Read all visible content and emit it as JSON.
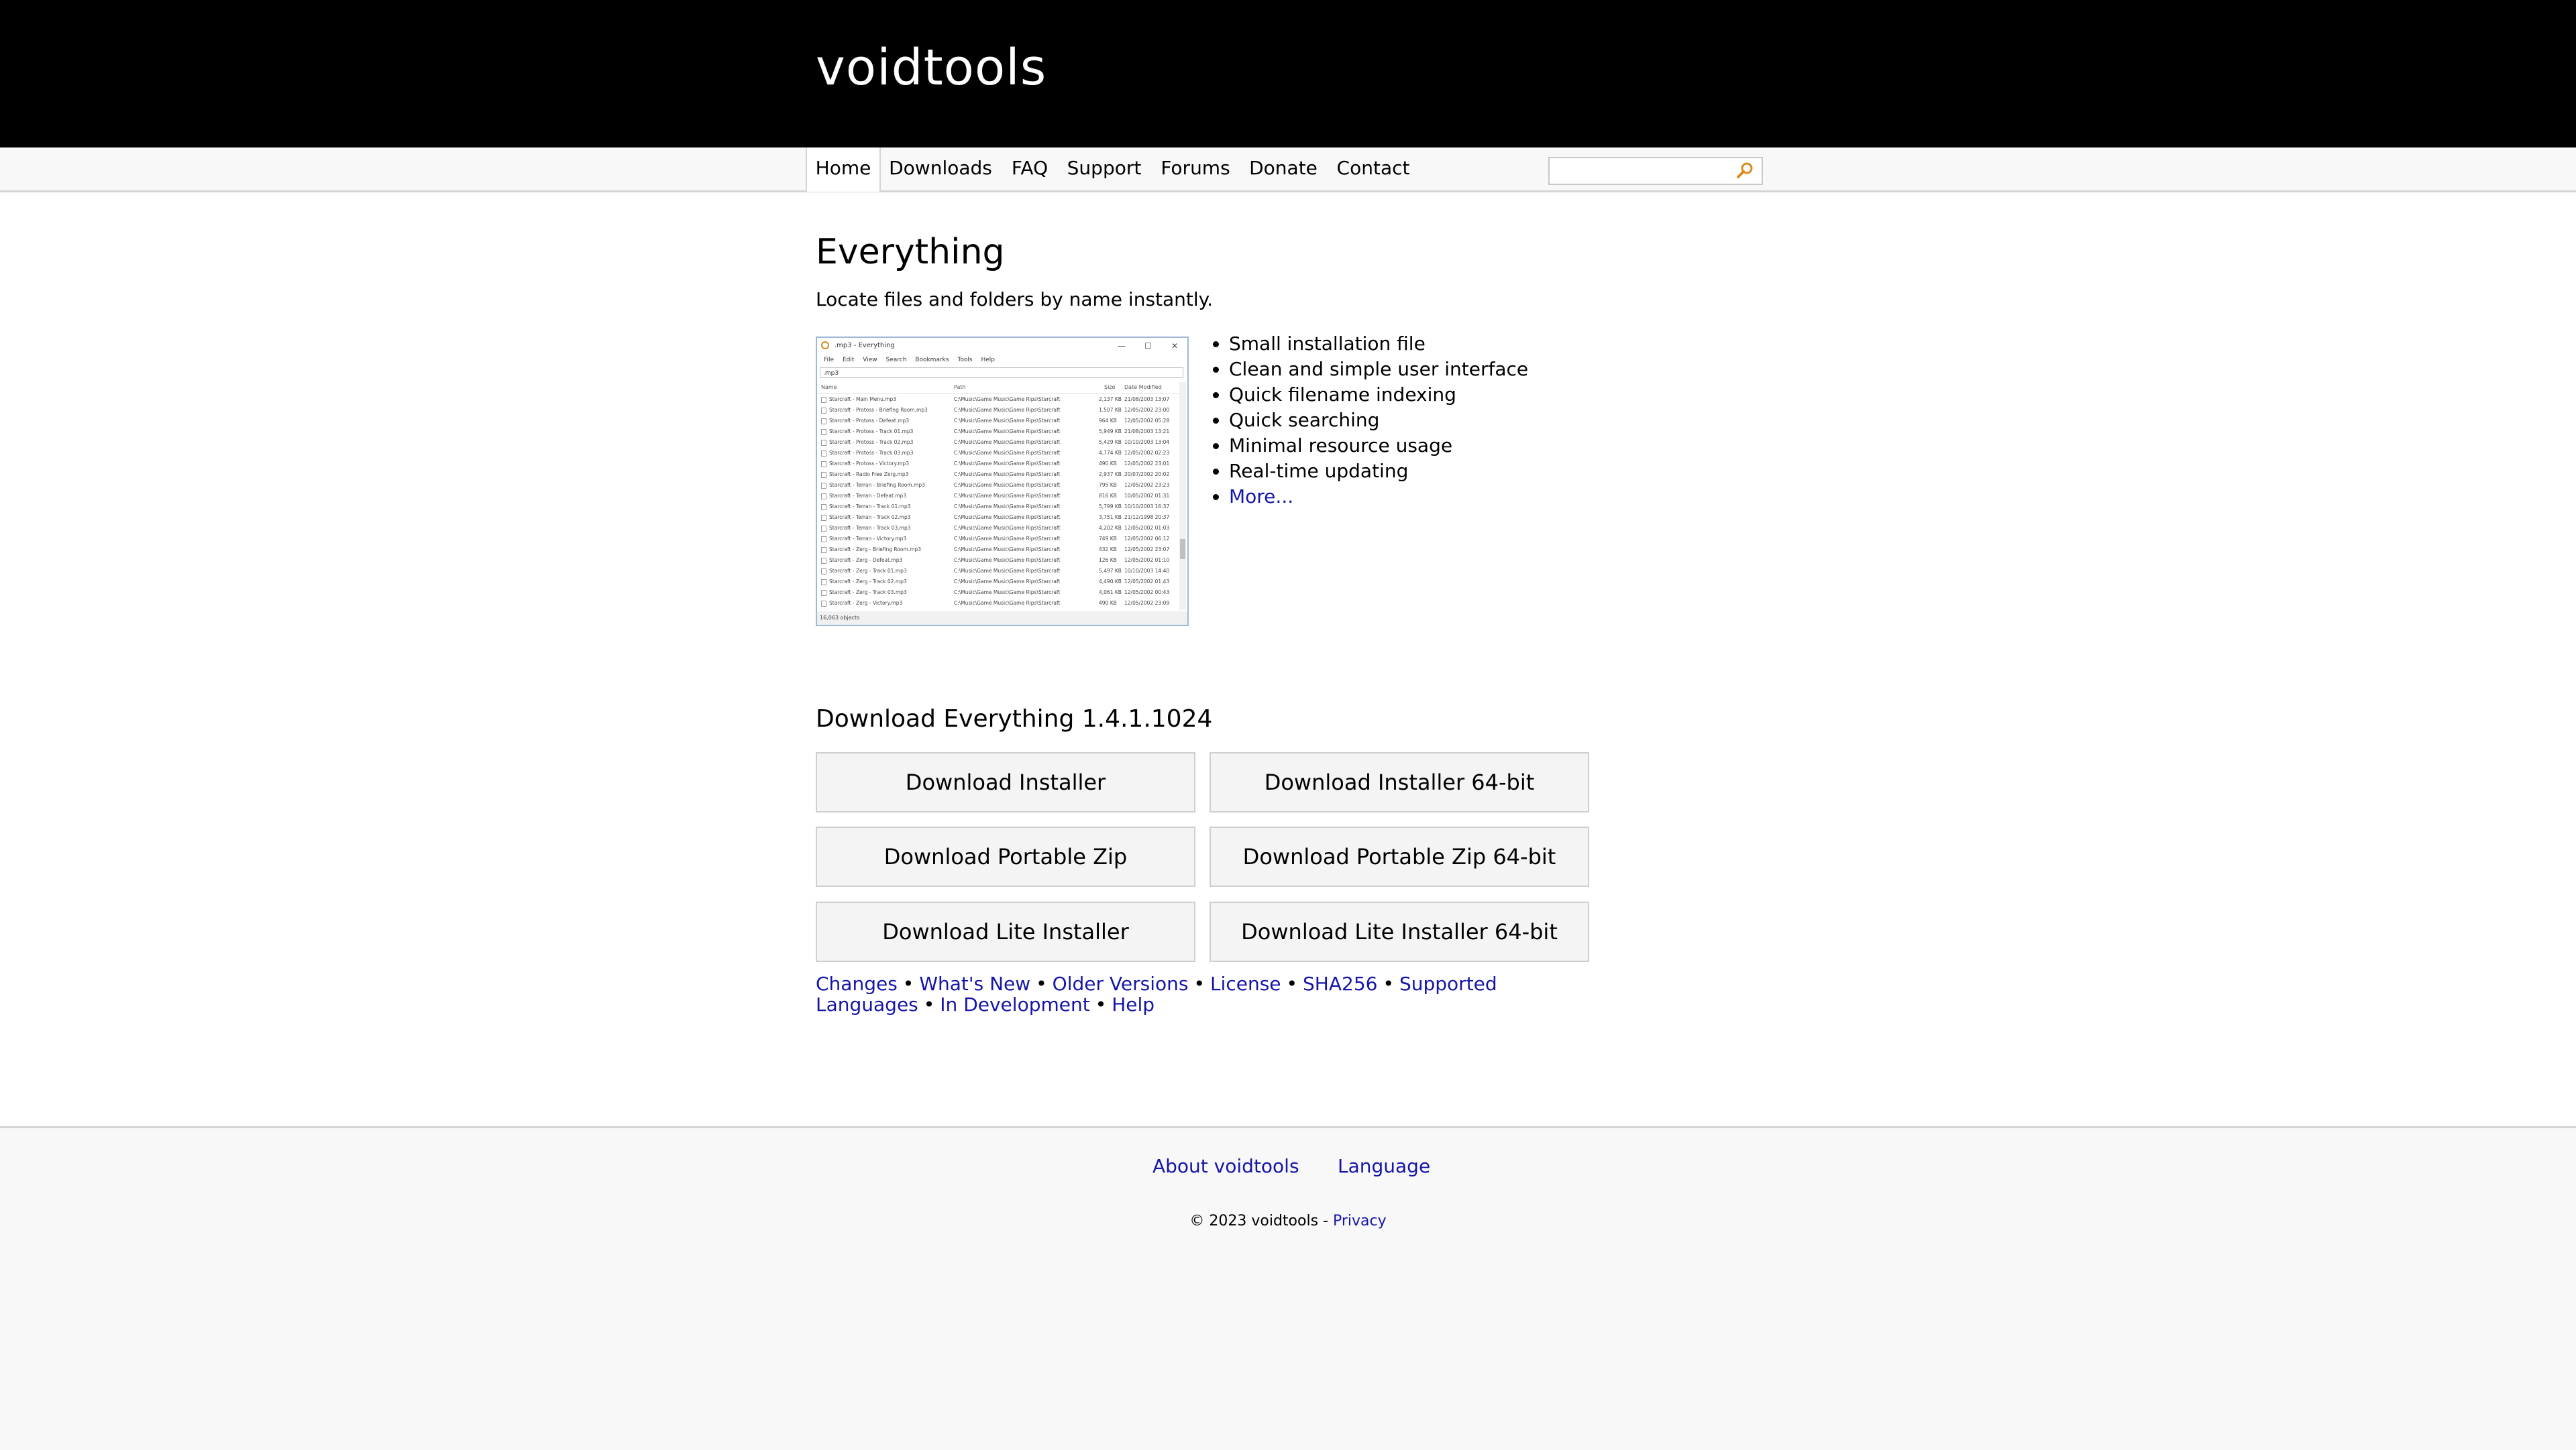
{
  "header": {
    "logo_text": "voidtools"
  },
  "nav": {
    "items": [
      {
        "label": "Home",
        "active": true
      },
      {
        "label": "Downloads"
      },
      {
        "label": "FAQ"
      },
      {
        "label": "Support"
      },
      {
        "label": "Forums"
      },
      {
        "label": "Donate"
      },
      {
        "label": "Contact"
      }
    ],
    "search": {
      "value": "",
      "icon": "search-icon"
    }
  },
  "main": {
    "title": "Everything",
    "tagline": "Locate files and folders by name instantly.",
    "screenshot": {
      "window_title": ".mp3 - Everything",
      "menu": [
        "File",
        "Edit",
        "View",
        "Search",
        "Bookmarks",
        "Tools",
        "Help"
      ],
      "search_value": ".mp3",
      "columns": [
        "Name",
        "Path",
        "Size",
        "Date Modified"
      ],
      "rows": [
        {
          "name": "Starcraft - Main Menu.mp3",
          "path": "C:\\Music\\Game Music\\Game Rips\\Starcraft",
          "size": "2,137 KB",
          "date": "21/08/2003 13:07"
        },
        {
          "name": "Starcraft - Protoss - Briefing Room.mp3",
          "path": "C:\\Music\\Game Music\\Game Rips\\Starcraft",
          "size": "1,507 KB",
          "date": "12/05/2002 23:00"
        },
        {
          "name": "Starcraft - Protoss - Defeat.mp3",
          "path": "C:\\Music\\Game Music\\Game Rips\\Starcraft",
          "size": "964 KB",
          "date": "12/05/2002 05:28"
        },
        {
          "name": "Starcraft - Protoss - Track 01.mp3",
          "path": "C:\\Music\\Game Music\\Game Rips\\Starcraft",
          "size": "5,949 KB",
          "date": "21/08/2003 13:21"
        },
        {
          "name": "Starcraft - Protoss - Track 02.mp3",
          "path": "C:\\Music\\Game Music\\Game Rips\\Starcraft",
          "size": "5,429 KB",
          "date": "10/10/2003 13:04"
        },
        {
          "name": "Starcraft - Protoss - Track 03.mp3",
          "path": "C:\\Music\\Game Music\\Game Rips\\Starcraft",
          "size": "4,774 KB",
          "date": "12/05/2002 02:23"
        },
        {
          "name": "Starcraft - Protoss - Victory.mp3",
          "path": "C:\\Music\\Game Music\\Game Rips\\Starcraft",
          "size": "490 KB",
          "date": "12/05/2002 23:01"
        },
        {
          "name": "Starcraft - Radio Free Zerg.mp3",
          "path": "C:\\Music\\Game Music\\Game Rips\\Starcraft",
          "size": "2,937 KB",
          "date": "20/07/2002 20:02"
        },
        {
          "name": "Starcraft - Terran - Briefing Room.mp3",
          "path": "C:\\Music\\Game Music\\Game Rips\\Starcraft",
          "size": "795 KB",
          "date": "12/05/2002 23:23"
        },
        {
          "name": "Starcraft - Terran - Defeat.mp3",
          "path": "C:\\Music\\Game Music\\Game Rips\\Starcraft",
          "size": "816 KB",
          "date": "10/05/2002 01:31"
        },
        {
          "name": "Starcraft - Terran - Track 01.mp3",
          "path": "C:\\Music\\Game Music\\Game Rips\\Starcraft",
          "size": "5,799 KB",
          "date": "10/10/2003 16:37"
        },
        {
          "name": "Starcraft - Terran - Track 02.mp3",
          "path": "C:\\Music\\Game Music\\Game Rips\\Starcraft",
          "size": "3,751 KB",
          "date": "21/12/1998 20:37"
        },
        {
          "name": "Starcraft - Terran - Track 03.mp3",
          "path": "C:\\Music\\Game Music\\Game Rips\\Starcraft",
          "size": "4,202 KB",
          "date": "12/05/2002 01:03"
        },
        {
          "name": "Starcraft - Terran - Victory.mp3",
          "path": "C:\\Music\\Game Music\\Game Rips\\Starcraft",
          "size": "749 KB",
          "date": "12/05/2002 06:12"
        },
        {
          "name": "Starcraft - Zerg - Briefing Room.mp3",
          "path": "C:\\Music\\Game Music\\Game Rips\\Starcraft",
          "size": "432 KB",
          "date": "12/05/2002 23:07"
        },
        {
          "name": "Starcraft - Zerg - Defeat.mp3",
          "path": "C:\\Music\\Game Music\\Game Rips\\Starcraft",
          "size": "126 KB",
          "date": "12/05/2002 01:10"
        },
        {
          "name": "Starcraft - Zerg - Track 01.mp3",
          "path": "C:\\Music\\Game Music\\Game Rips\\Starcraft",
          "size": "5,497 KB",
          "date": "10/10/2003 14:40"
        },
        {
          "name": "Starcraft - Zerg - Track 02.mp3",
          "path": "C:\\Music\\Game Music\\Game Rips\\Starcraft",
          "size": "4,490 KB",
          "date": "12/05/2002 01:43"
        },
        {
          "name": "Starcraft - Zerg - Track 03.mp3",
          "path": "C:\\Music\\Game Music\\Game Rips\\Starcraft",
          "size": "4,061 KB",
          "date": "12/05/2002 00:43"
        },
        {
          "name": "Starcraft - Zerg - Victory.mp3",
          "path": "C:\\Music\\Game Music\\Game Rips\\Starcraft",
          "size": "490 KB",
          "date": "12/05/2002 23:09"
        }
      ],
      "status": "16,063 objects"
    },
    "features": [
      {
        "label": "Small installation file"
      },
      {
        "label": "Clean and simple user interface"
      },
      {
        "label": "Quick filename indexing"
      },
      {
        "label": "Quick searching"
      },
      {
        "label": "Minimal resource usage"
      },
      {
        "label": "Real-time updating"
      },
      {
        "label": "More...",
        "link": true
      }
    ]
  },
  "download": {
    "title": "Download Everything 1.4.1.1024",
    "buttons": [
      {
        "label": "Download Installer"
      },
      {
        "label": "Download Installer 64-bit"
      },
      {
        "label": "Download Portable Zip"
      },
      {
        "label": "Download Portable Zip 64-bit"
      },
      {
        "label": "Download Lite Installer"
      },
      {
        "label": "Download Lite Installer 64-bit"
      }
    ],
    "links": [
      "Changes",
      "What's New",
      "Older Versions",
      "License",
      "SHA256",
      "Supported Languages",
      "In Development",
      "Help"
    ],
    "separator": "•"
  },
  "footer": {
    "about": "About voidtools",
    "language": "Language",
    "copyright": "© 2023 voidtools - ",
    "privacy": "Privacy"
  },
  "colors": {
    "header_bg": "#000000",
    "link": "#1515a8",
    "footer_bg": "#f8f8f8"
  }
}
